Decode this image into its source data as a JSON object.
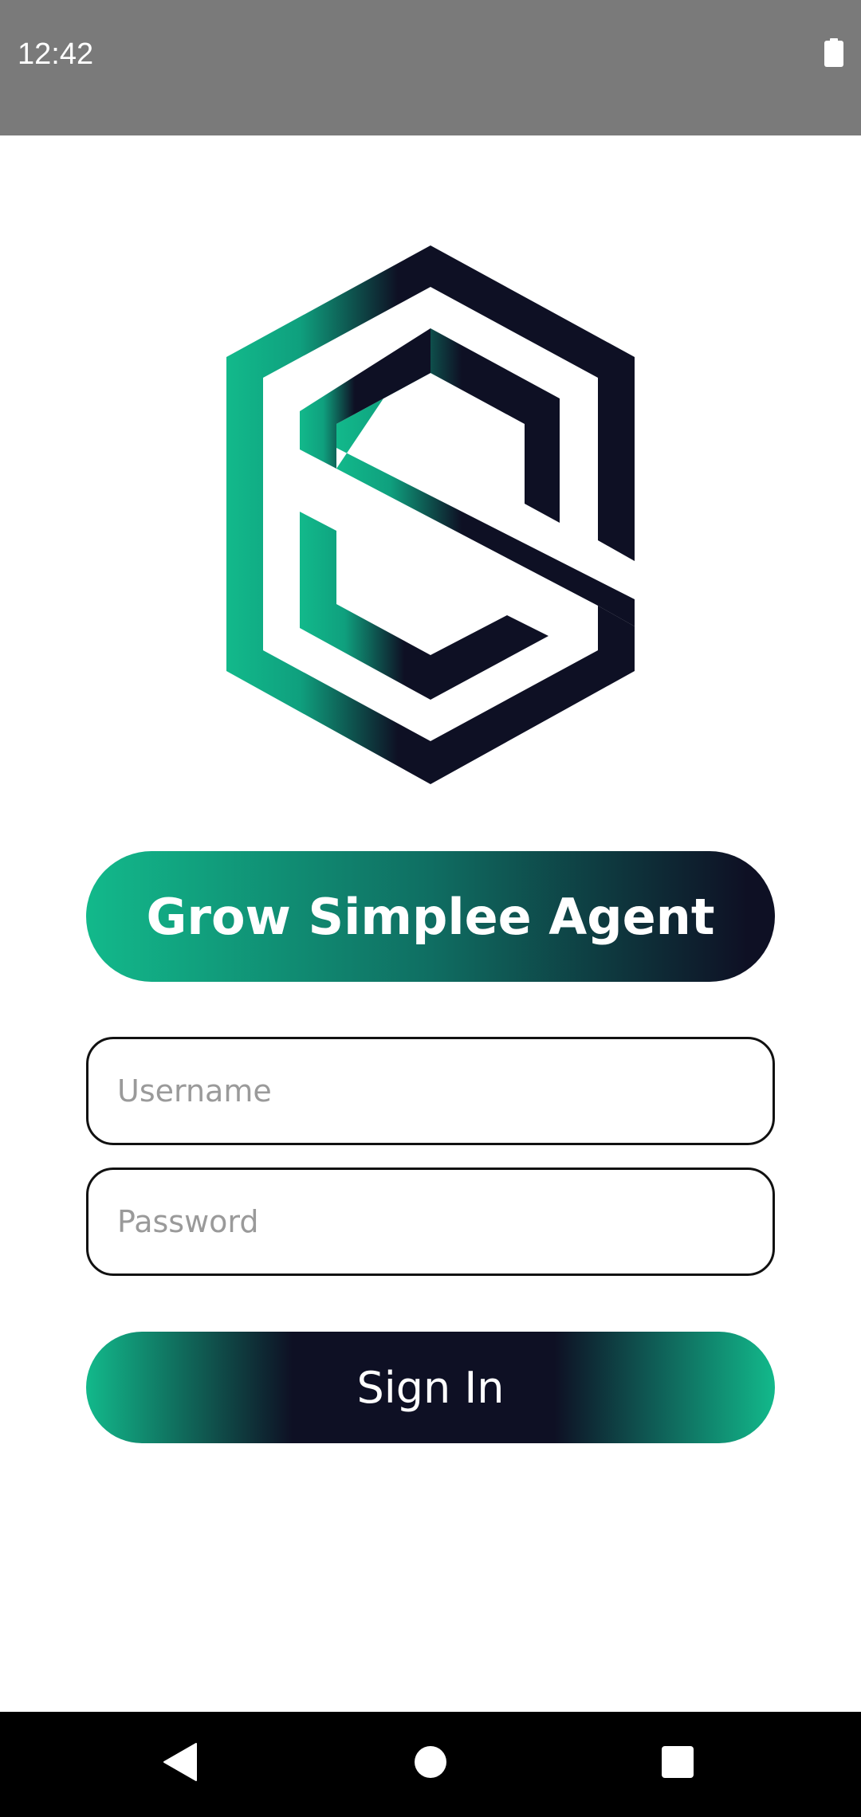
{
  "status_bar": {
    "time": "12:42",
    "battery_icon": "battery-full-icon"
  },
  "logo": {
    "icon": "grow-simplee-s-hexagon-logo",
    "colors": {
      "green": "#12b98b",
      "navy": "#0e1024"
    }
  },
  "app": {
    "title": "Grow Simplee Agent"
  },
  "form": {
    "username_placeholder": "Username",
    "username_value": "",
    "password_placeholder": "Password",
    "password_value": "",
    "signin_label": "Sign In"
  },
  "nav_bar": {
    "back_icon": "back-triangle-icon",
    "home_icon": "home-circle-icon",
    "recents_icon": "recents-square-icon"
  },
  "colors": {
    "accent_green": "#12b98b",
    "accent_navy": "#0e1024",
    "status_bar": "#7a7a7a"
  }
}
